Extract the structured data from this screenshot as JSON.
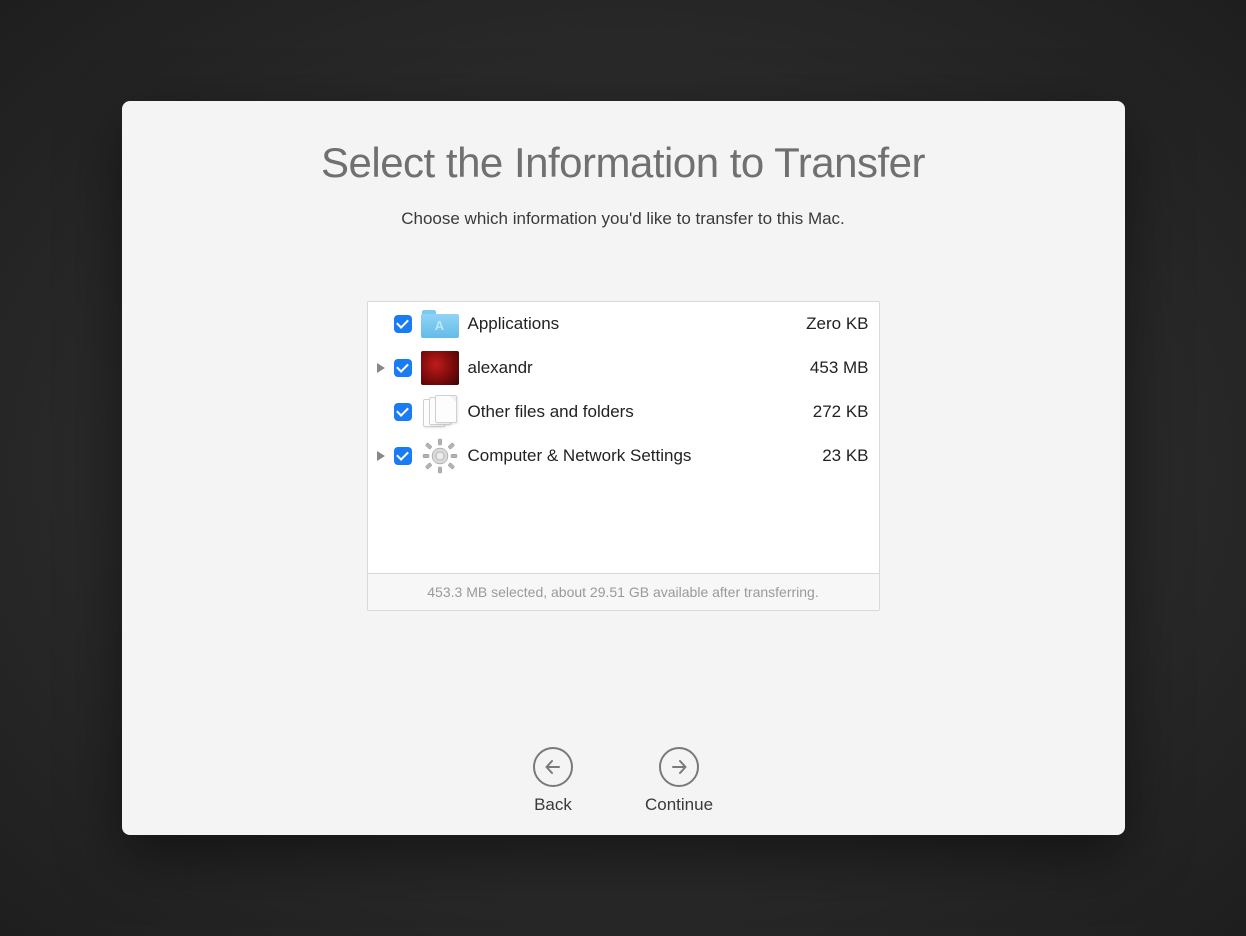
{
  "title": "Select the Information to Transfer",
  "subtitle": "Choose which information you'd like to transfer to this Mac.",
  "items": [
    {
      "label": "Applications",
      "size": "Zero KB",
      "checked": true,
      "expandable": false,
      "icon": "applications-folder-icon"
    },
    {
      "label": "alexandr",
      "size": "453 MB",
      "checked": true,
      "expandable": true,
      "icon": "user-avatar-rose-icon"
    },
    {
      "label": "Other files and folders",
      "size": "272 KB",
      "checked": true,
      "expandable": false,
      "icon": "documents-icon"
    },
    {
      "label": "Computer & Network Settings",
      "size": "23 KB",
      "checked": true,
      "expandable": true,
      "icon": "gear-icon"
    }
  ],
  "status": "453.3 MB selected, about 29.51 GB available after transferring.",
  "buttons": {
    "back": "Back",
    "continue": "Continue"
  }
}
